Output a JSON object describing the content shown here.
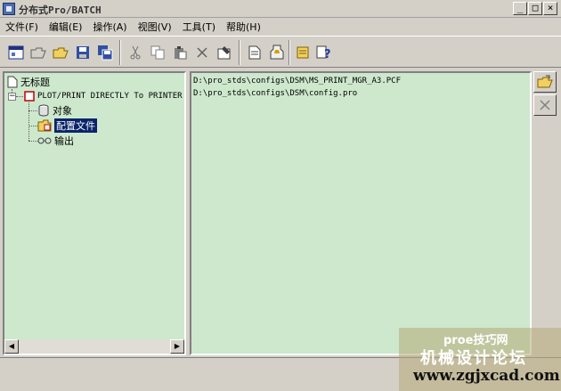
{
  "window": {
    "title": "分布式Pro/BATCH",
    "min": "_",
    "max": "□",
    "close": "×"
  },
  "menu": [
    "文件(F)",
    "编辑(E)",
    "操作(A)",
    "视图(V)",
    "工具(T)",
    "帮助(H)"
  ],
  "tree": {
    "root": "无标题",
    "job": "PLOT/PRINT DIRECTLY To PRINTER",
    "objects": "对象",
    "config": "配置文件",
    "output": "输出"
  },
  "files": [
    "D:\\pro_stds\\configs\\DSM\\MS_PRINT_MGR_A3.PCF",
    "D:\\pro_stds\\configs\\DSM\\config.pro"
  ],
  "watermark": {
    "line1": "proe技巧网",
    "line2": "机械设计论坛",
    "line3": "www.zgjxcad.com"
  },
  "colors": {
    "panel_bg": "#cde8cd",
    "selection": "#0a246a",
    "chrome": "#d4d0c8"
  }
}
